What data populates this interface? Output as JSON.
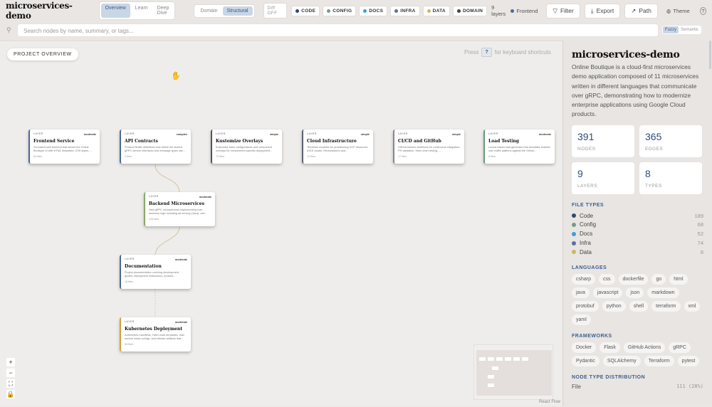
{
  "app": {
    "title": "microservices-demo"
  },
  "view_tabs": [
    {
      "label": "Overview",
      "active": true
    },
    {
      "label": "Learn",
      "active": false
    },
    {
      "label": "Deep Dive",
      "active": false
    }
  ],
  "mode_tabs": [
    {
      "label": "Domain",
      "active": false
    },
    {
      "label": "Structural",
      "active": true
    }
  ],
  "diff": "Diff OFF",
  "filters": [
    {
      "label": "CODE",
      "color": "#2f4a6b"
    },
    {
      "label": "CONFIG",
      "color": "#7a9a88"
    },
    {
      "label": "DOCS",
      "color": "#3aa0dc"
    },
    {
      "label": "INFRA",
      "color": "#5a6fa8"
    },
    {
      "label": "DATA",
      "color": "#c8b860"
    },
    {
      "label": "DOMAIN",
      "color": "#444444"
    }
  ],
  "layers_count": "9 layers",
  "frontend_chip": "Frontend",
  "toolbar": {
    "filter": "Filter",
    "export": "Export",
    "path": "Path",
    "theme": "Theme",
    "help": "?"
  },
  "search": {
    "placeholder": "Search nodes by name, summary, or tags...",
    "modes": [
      {
        "label": "Fuzzy",
        "active": true
      },
      {
        "label": "Semantic",
        "active": false
      }
    ]
  },
  "canvas": {
    "overview_button": "PROJECT OVERVIEW",
    "hint_pre": "Press",
    "hint_key": "?",
    "hint_post": "for keyboard shortcuts",
    "attribution": "React Flow",
    "nodes": [
      {
        "label": "LAYER",
        "complexity": "moderate",
        "title": "Frontend Service",
        "desc": "Go-based web frontend that serves the Online Boutique UI with HTML templates, CSS styles, ...",
        "files": "34 files",
        "color": "#4a6a9a"
      },
      {
        "label": "LAYER",
        "complexity": "complex",
        "title": "API Contracts",
        "desc": "Protocol Buffer definitions that define the shared gRPC service interfaces and message types use...",
        "files": "2 files",
        "color": "#4a6a9a"
      },
      {
        "label": "LAYER",
        "complexity": "simple",
        "title": "Kustomize Overlays",
        "desc": "Kustomize base configurations and component overlays for environment-specific deployment...",
        "files": "70 files",
        "color": "#555555"
      },
      {
        "label": "LAYER",
        "complexity": "simple",
        "title": "Cloud Infrastructure",
        "desc": "Terraform modules for provisioning GCP resources (GKE cluster, Memorystore) and...",
        "files": "12 files",
        "color": "#5b6270"
      },
      {
        "label": "LAYER",
        "complexity": "simple",
        "title": "CI/CD and GitHub",
        "desc": "GitHub Actions workflows for continuous integration, PR validation, Helm chart testing, ...",
        "files": "17 files",
        "color": "#888888"
      },
      {
        "label": "LAYER",
        "complexity": "moderate",
        "title": "Load Testing",
        "desc": "Locust-based load generator that simulates realistic user traffic patterns against the Online...",
        "files": "6 files",
        "color": "#6a9a7a"
      },
      {
        "label": "LAYER",
        "complexity": "moderate",
        "title": "Backend Microservices",
        "desc": "New gRPC microservices implementing core business logic including ad serving (Java), cart...",
        "files": "104 files",
        "color": "#8aa86a"
      },
      {
        "label": "LAYER",
        "complexity": "moderate",
        "title": "Documentation",
        "desc": "Project documentation covering development guides, deployment instructions, product...",
        "files": "18 files",
        "color": "#4a6a9a"
      },
      {
        "label": "LAYER",
        "complexity": "moderate",
        "title": "Kubernetes Deployment",
        "desc": "Kubernetes manifests, Helm chart templates, Istio service mesh configs, and release artifacts that...",
        "files": "35 files",
        "color": "#d0a040"
      }
    ]
  },
  "sidebar": {
    "title": "microservices-demo",
    "description": "Online Boutique is a cloud-first microservices demo application composed of 11 microservices written in different languages that communicate over gRPC, demonstrating how to modernize enterprise applications using Google Cloud products.",
    "stats": [
      {
        "value": "391",
        "label": "NODES"
      },
      {
        "value": "365",
        "label": "EDGES"
      },
      {
        "value": "9",
        "label": "LAYERS"
      },
      {
        "value": "8",
        "label": "TYPES"
      }
    ],
    "file_types_heading": "FILE TYPES",
    "file_types": [
      {
        "label": "Code",
        "count": "189",
        "color": "#2f4a6b"
      },
      {
        "label": "Config",
        "count": "68",
        "color": "#7a9a88"
      },
      {
        "label": "Docs",
        "count": "52",
        "color": "#3aa0dc"
      },
      {
        "label": "Infra",
        "count": "74",
        "color": "#5a6fa8"
      },
      {
        "label": "Data",
        "count": "8",
        "color": "#c8b860"
      }
    ],
    "languages_heading": "LANGUAGES",
    "languages": [
      "csharp",
      "css",
      "dockerfile",
      "go",
      "html",
      "java",
      "javascript",
      "json",
      "markdown",
      "protobuf",
      "python",
      "shell",
      "terraform",
      "xml",
      "yaml"
    ],
    "frameworks_heading": "FRAMEWORKS",
    "frameworks": [
      "Docker",
      "Flask",
      "GitHub Actions",
      "gRPC",
      "Pydantic",
      "SQLAlchemy",
      "Terraform",
      "pytest"
    ],
    "distribution_heading": "NODE TYPE DISTRIBUTION",
    "distribution": [
      {
        "label": "File",
        "value": "111 (28%)"
      }
    ]
  }
}
